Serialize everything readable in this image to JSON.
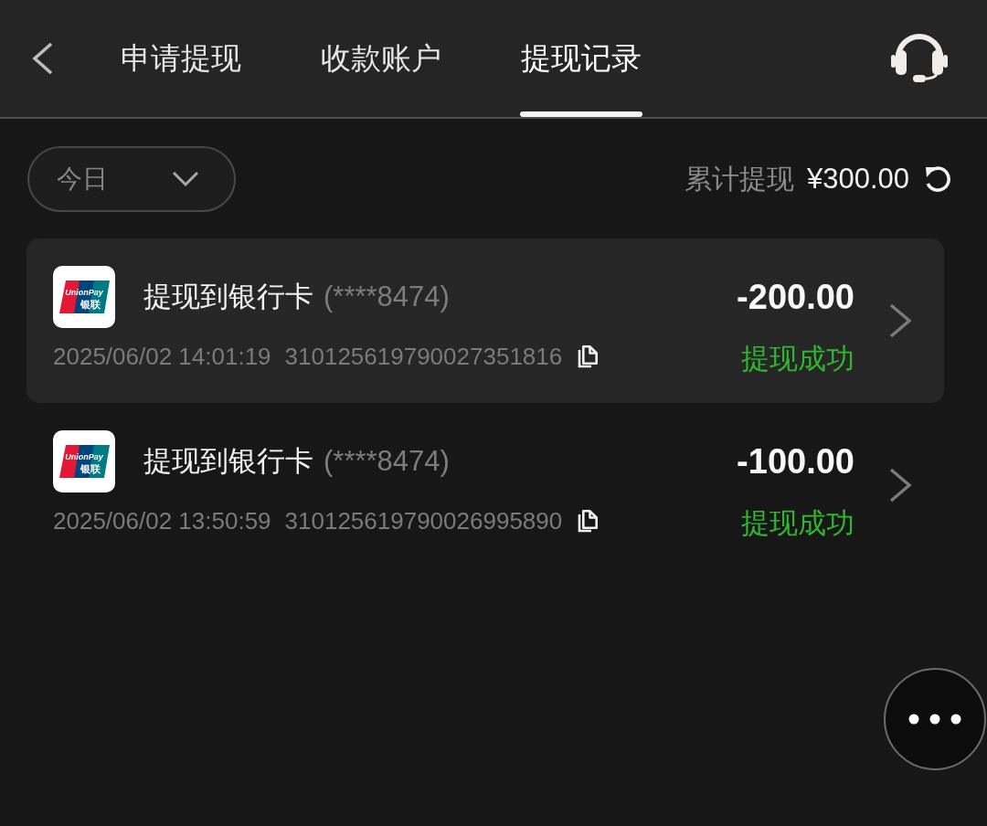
{
  "header": {
    "tabs": [
      {
        "label": "申请提现",
        "selected": false
      },
      {
        "label": "收款账户",
        "selected": false
      },
      {
        "label": "提现记录",
        "selected": true
      }
    ]
  },
  "filter": {
    "value": "今日"
  },
  "summary": {
    "label": "累计提现",
    "amount": "¥300.00"
  },
  "records": [
    {
      "selected": true,
      "logo_text": "UnionPay",
      "logo_text_cn": "银联",
      "title": "提现到银行卡",
      "account": "(****8474)",
      "time": "2025/06/02 14:01:19",
      "serial": "310125619790027351816",
      "amount": "-200.00",
      "status": "提现成功"
    },
    {
      "selected": false,
      "logo_text": "UnionPay",
      "logo_text_cn": "银联",
      "title": "提现到银行卡",
      "account": "(****8474)",
      "time": "2025/06/02 13:50:59",
      "serial": "310125619790026995890",
      "amount": "-100.00",
      "status": "提现成功"
    }
  ]
}
